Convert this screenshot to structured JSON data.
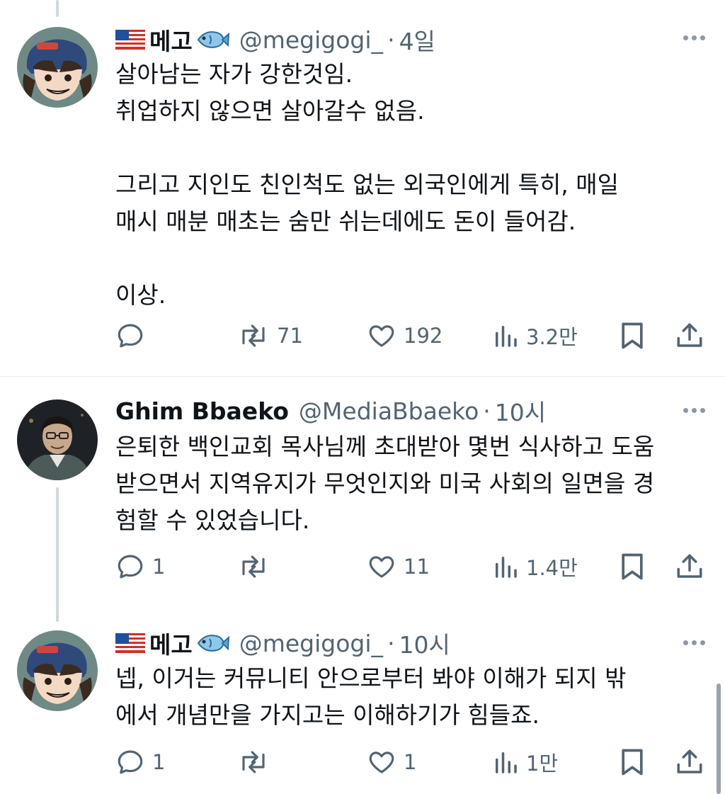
{
  "tweets": [
    {
      "name": "메고",
      "handle": "@megigogi_",
      "dot": "·",
      "time": "4일",
      "lines": [
        "살아남는 자가 강한것임.",
        "취업하지 않으면 살아갈수 없음.",
        "",
        "그리고 지인도 친인척도 없는 외국인에게 특히, 매일",
        "매시 매분 매초는 숨만 쉬는데에도 돈이 들어감.",
        "",
        "이상."
      ],
      "reply_count": "",
      "retweet_count": "71",
      "like_count": "192",
      "view_count": "3.2만"
    },
    {
      "name": "Ghim Bbaeko",
      "handle": "@MediaBbaeko",
      "dot": "·",
      "time": "10시",
      "lines": [
        "은퇴한 백인교회 목사님께 초대받아 몇번 식사하고 도움",
        "받으면서 지역유지가 무엇인지와 미국 사회의 일면을 경",
        "험할 수 있었습니다."
      ],
      "reply_count": "1",
      "retweet_count": "",
      "like_count": "11",
      "view_count": "1.4만"
    },
    {
      "name": "메고",
      "handle": "@megigogi_",
      "dot": "·",
      "time": "10시",
      "lines": [
        "넵, 이거는 커뮤니티 안으로부터 봐야 이해가 되지 밖",
        "에서 개념만을 가지고는 이해하기가 힘들죠."
      ],
      "reply_count": "1",
      "retweet_count": "",
      "like_count": "1",
      "view_count": "1만"
    }
  ]
}
